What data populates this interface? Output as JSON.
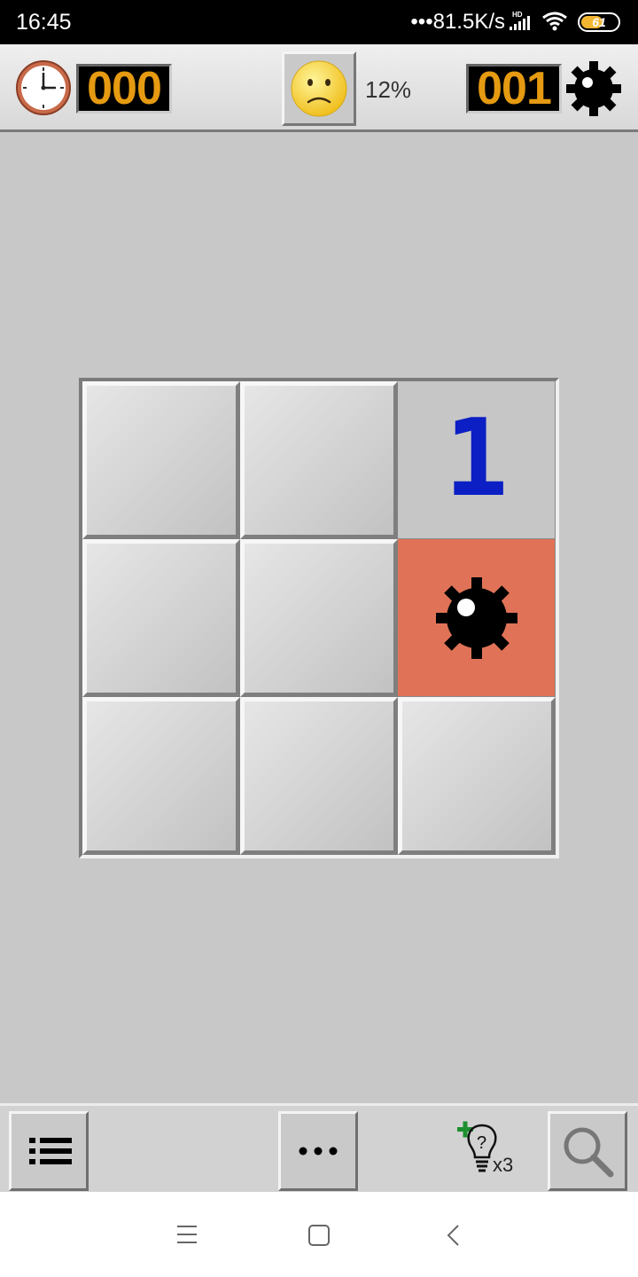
{
  "status_bar": {
    "time": "16:45",
    "network_speed": "•••81.5K/s",
    "signal_badge": "HD",
    "battery_level": "61",
    "battery_fraction": 0.61
  },
  "header": {
    "timer_value": "000",
    "percent": "12%",
    "mines_value": "001",
    "face": "sad-face"
  },
  "board": {
    "rows": 3,
    "cols": 3,
    "cells": [
      [
        "closed",
        "closed",
        "1"
      ],
      [
        "closed",
        "closed",
        "mine-exploded"
      ],
      [
        "closed",
        "closed",
        "closed"
      ]
    ]
  },
  "toolbar": {
    "hint_count": "x3",
    "hint_symbol": "?"
  },
  "colors": {
    "counter_digits": "#e59a11",
    "number_one": "#0b1fc4",
    "exploded_cell": "#e07357",
    "hint_plus": "#1d8f2e"
  }
}
